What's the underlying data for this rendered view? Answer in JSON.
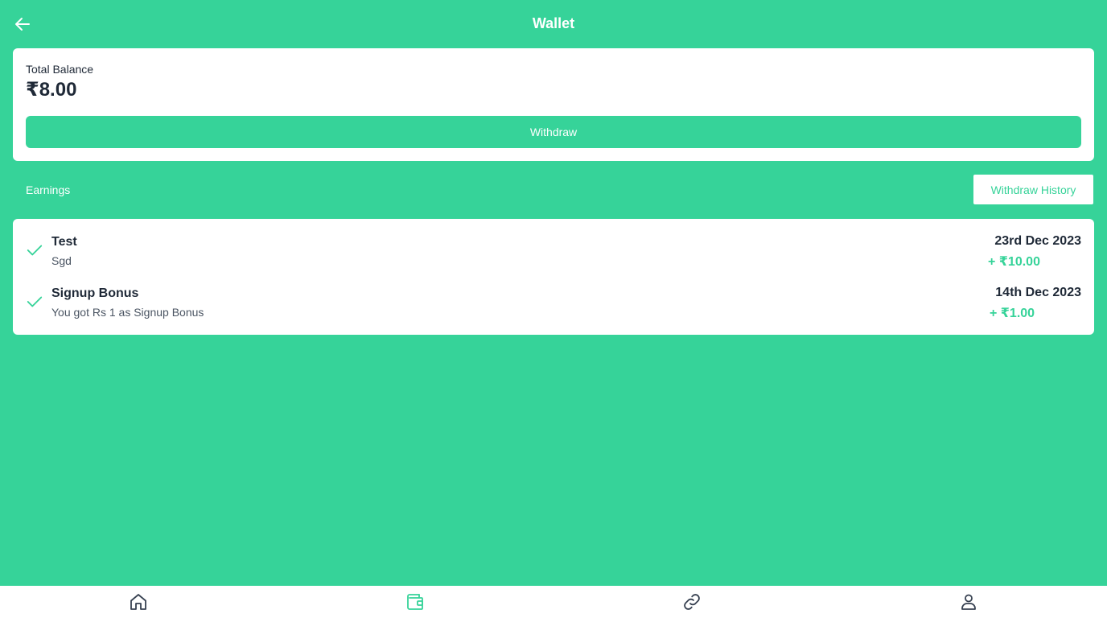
{
  "header": {
    "title": "Wallet",
    "back_icon": "arrow-left-icon"
  },
  "balance": {
    "label": "Total Balance",
    "amount": "₹8.00",
    "withdraw_label": "Withdraw"
  },
  "earnings_section": {
    "label": "Earnings",
    "history_button": "Withdraw History"
  },
  "earnings": [
    {
      "title": "Test",
      "description": "Sgd",
      "date": "23rd Dec 2023",
      "amount": "+ ₹10.00",
      "status_icon": "check-icon"
    },
    {
      "title": "Signup Bonus",
      "description": "You got Rs 1 as Signup Bonus",
      "date": "14th Dec 2023",
      "amount": "+ ₹1.00",
      "status_icon": "check-icon"
    }
  ],
  "bottom_nav": {
    "items": [
      {
        "icon": "home-icon",
        "active": false
      },
      {
        "icon": "wallet-icon",
        "active": true
      },
      {
        "icon": "link-icon",
        "active": false
      },
      {
        "icon": "user-icon",
        "active": false
      }
    ]
  },
  "colors": {
    "accent": "#36d399",
    "text": "#1f2937",
    "muted": "#4b5563",
    "nav_inactive": "#374151"
  }
}
